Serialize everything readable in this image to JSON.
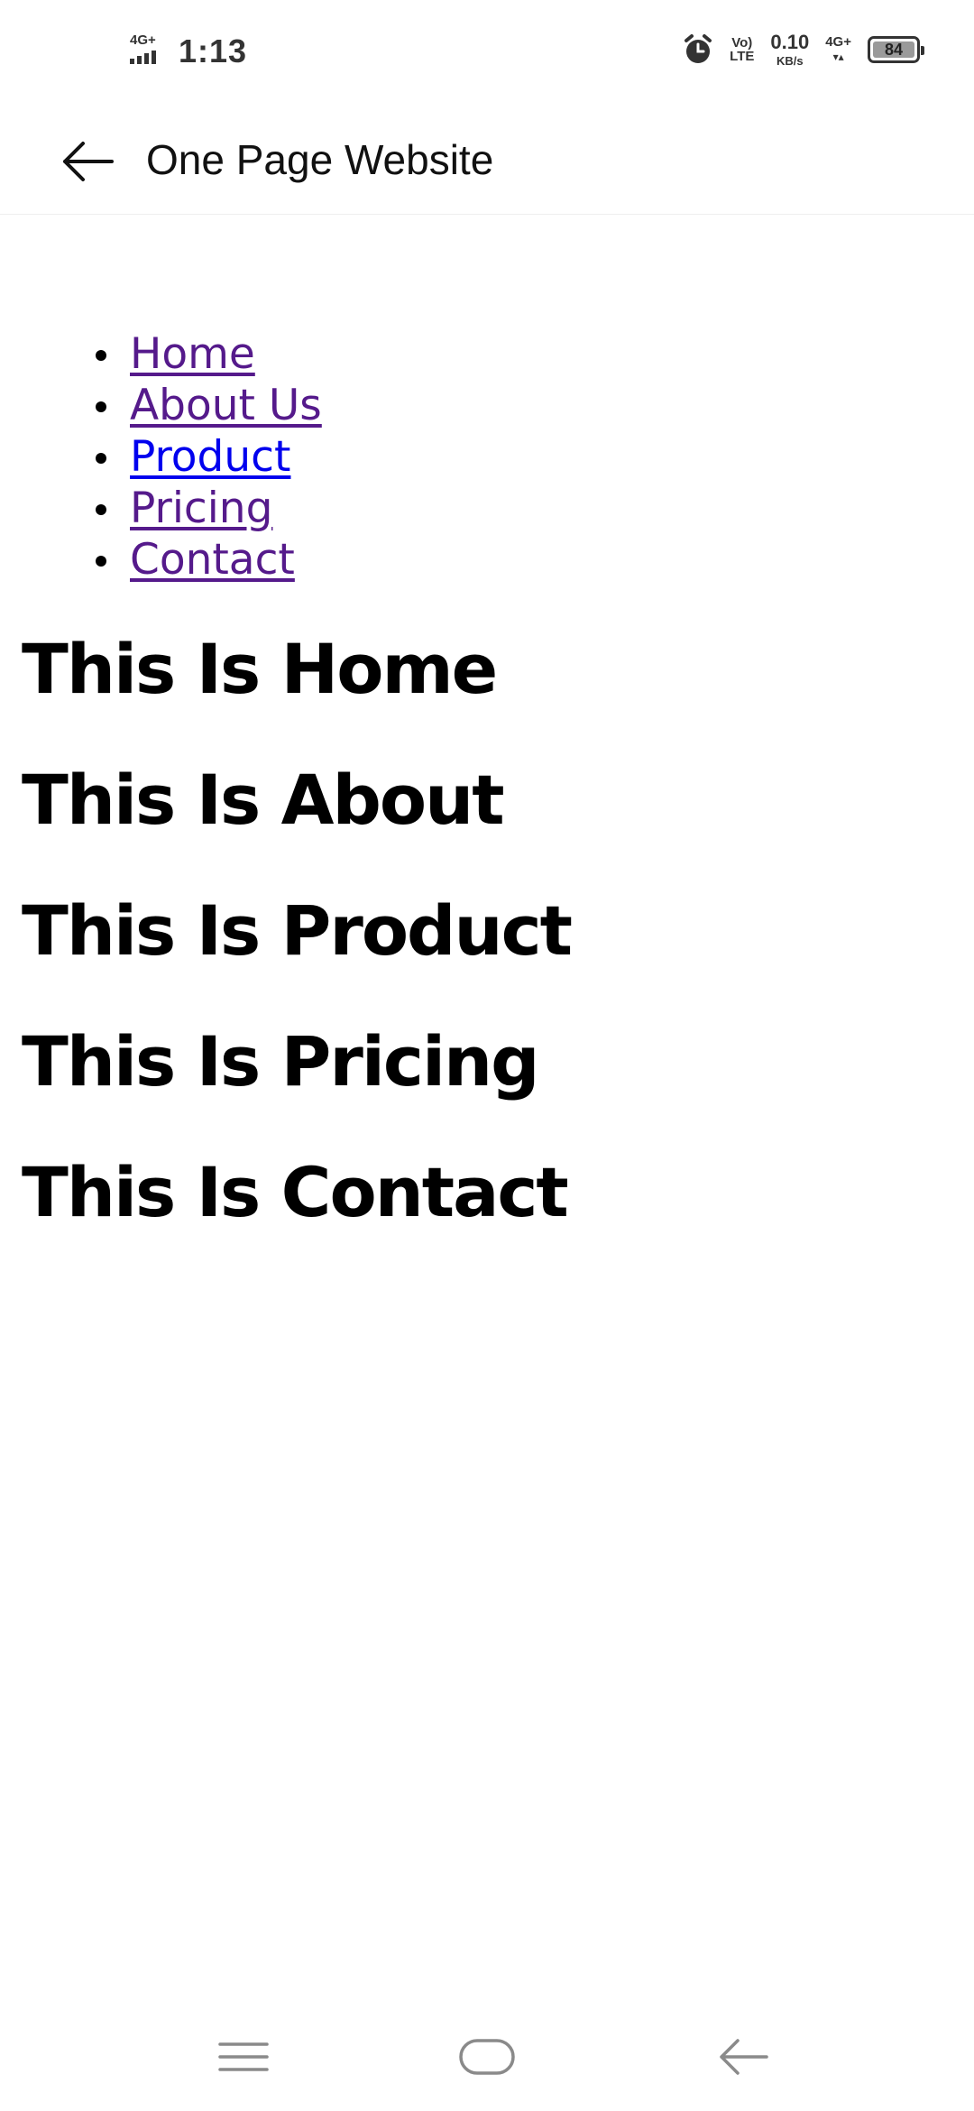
{
  "status_bar": {
    "network_left": "4G+",
    "time": "1:13",
    "volte_top": "Vo)",
    "volte_bottom": "LTE",
    "speed_value": "0.10",
    "speed_unit": "KB/s",
    "network_right": "4G+",
    "battery_level": "84",
    "icons": [
      "signal-icon",
      "alarm-icon",
      "volte-icon",
      "battery-icon"
    ]
  },
  "app_bar": {
    "title": "One Page Website",
    "back_icon": "arrow-left-icon"
  },
  "nav_links": [
    {
      "label": "Home",
      "visited": true
    },
    {
      "label": "About Us",
      "visited": true
    },
    {
      "label": "Product",
      "visited": false
    },
    {
      "label": "Pricing",
      "visited": true
    },
    {
      "label": "Contact",
      "visited": true
    }
  ],
  "sections": [
    {
      "heading": "This Is Home"
    },
    {
      "heading": "This Is About"
    },
    {
      "heading": "This Is Product"
    },
    {
      "heading": "This Is Pricing"
    },
    {
      "heading": "This Is Contact"
    }
  ],
  "system_nav": {
    "icons": [
      "menu-icon",
      "home-icon",
      "back-icon"
    ]
  },
  "colors": {
    "visited_link": "#551a8b",
    "unvisited_link": "#0000ee",
    "status_text": "#333333"
  }
}
